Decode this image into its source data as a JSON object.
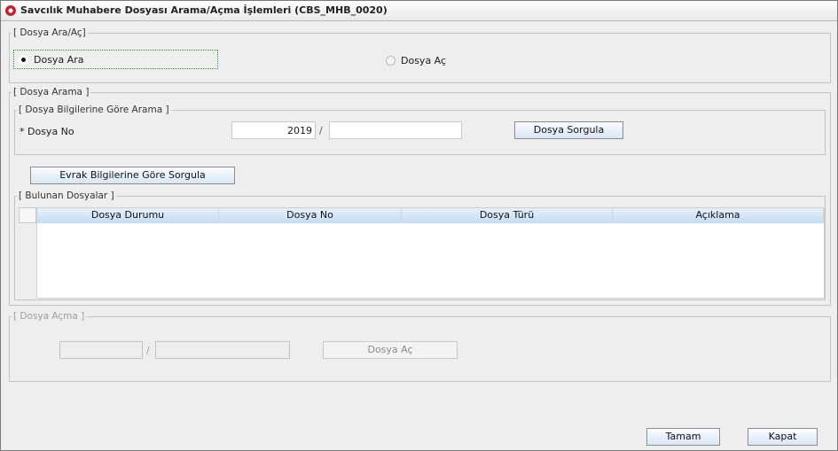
{
  "window": {
    "title": "Savcılık Muhabere Dosyası Arama/Açma İşlemleri (CBS_MHB_0020)"
  },
  "dosya_ara_ac": {
    "legend": "[ Dosya Ara/Aç]",
    "option_ara": {
      "label": "Dosya Ara",
      "selected": true
    },
    "option_ac": {
      "label": "Dosya Aç",
      "selected": false
    }
  },
  "dosya_arama": {
    "legend": "[ Dosya Arama ]",
    "bilgi": {
      "legend": "[ Dosya Bilgilerine Göre Arama ]",
      "dosya_no_label": "* Dosya No",
      "year_value": "2019",
      "separator": "/",
      "number_value": "",
      "sorgula_button": "Dosya Sorgula"
    },
    "evrak_button": "Evrak Bilgilerine Göre Sorgula",
    "bulunan": {
      "legend": "[ Bulunan Dosyalar ]",
      "columns": [
        "Dosya Durumu",
        "Dosya No",
        "Dosya Türü",
        "Açıklama"
      ],
      "rows": []
    }
  },
  "dosya_acma": {
    "legend": "[ Dosya Açma ]",
    "year_value": "",
    "separator": "/",
    "number_value": "",
    "ac_button": "Dosya Aç"
  },
  "footer": {
    "tamam_button": "Tamam",
    "kapat_button": "Kapat"
  },
  "colors": {
    "button_gradient_bottom": "#d8e6f6",
    "header_gradient_bottom": "#c4dcf4",
    "focus_ring": "#2f8f2f",
    "window_bg": "#eeeeee"
  }
}
